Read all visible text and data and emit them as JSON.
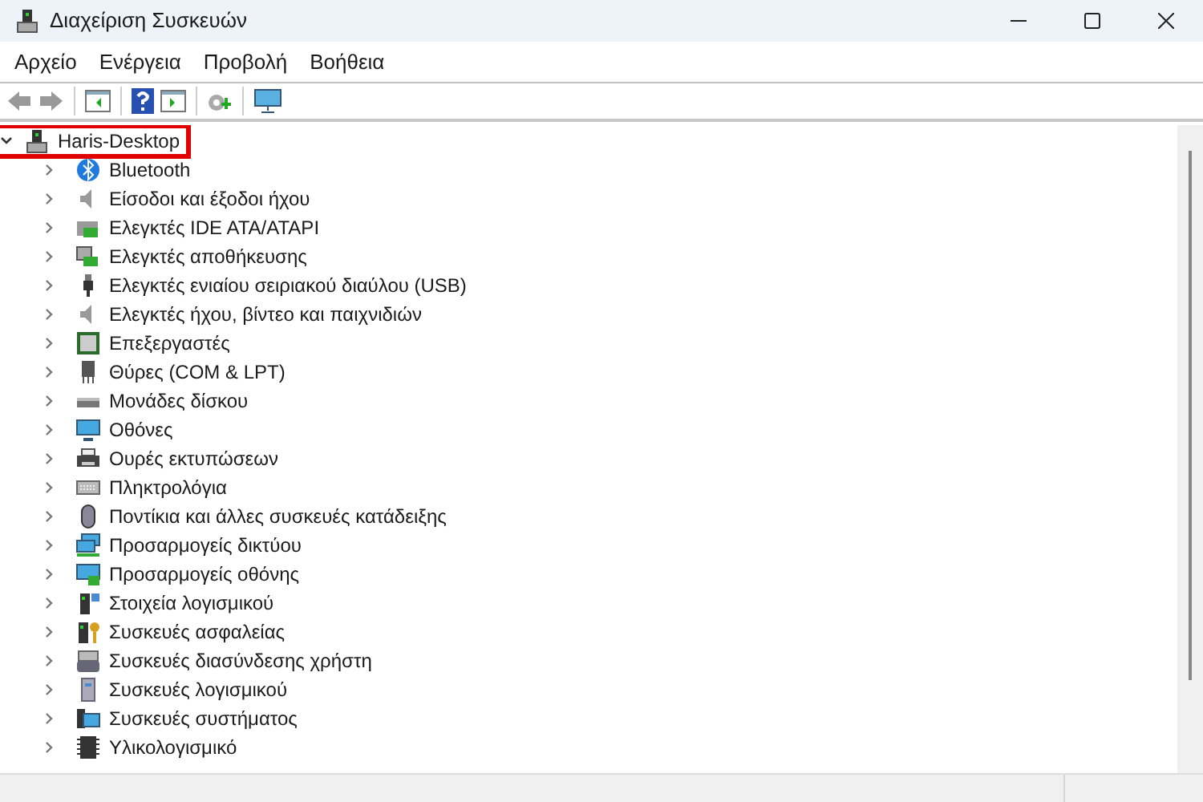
{
  "window": {
    "title": "Διαχείριση Συσκευών"
  },
  "menu": [
    "Αρχείο",
    "Ενέργεια",
    "Προβολή",
    "Βοήθεια"
  ],
  "tree": {
    "label": "Haris-Desktop",
    "expanded": true,
    "highlighted": true,
    "children": [
      {
        "label": "Bluetooth",
        "expanded": false
      },
      {
        "label": "Είσοδοι και έξοδοι ήχου",
        "expanded": false
      },
      {
        "label": "Ελεγκτές IDE ATA/ATAPI",
        "expanded": false
      },
      {
        "label": "Ελεγκτές αποθήκευσης",
        "expanded": false
      },
      {
        "label": "Ελεγκτές ενιαίου σειριακού διαύλου (USB)",
        "expanded": false
      },
      {
        "label": "Ελεγκτές ήχου, βίντεο και παιχνιδιών",
        "expanded": false
      },
      {
        "label": "Επεξεργαστές",
        "expanded": false
      },
      {
        "label": "Θύρες (COM & LPT)",
        "expanded": false
      },
      {
        "label": "Μονάδες δίσκου",
        "expanded": false
      },
      {
        "label": "Οθόνες",
        "expanded": false
      },
      {
        "label": "Ουρές εκτυπώσεων",
        "expanded": false
      },
      {
        "label": "Πληκτρολόγια",
        "expanded": false
      },
      {
        "label": "Ποντίκια και άλλες συσκευές κατάδειξης",
        "expanded": false
      },
      {
        "label": "Προσαρμογείς δικτύου",
        "expanded": false
      },
      {
        "label": "Προσαρμογείς οθόνης",
        "expanded": false
      },
      {
        "label": "Στοιχεία λογισμικού",
        "expanded": false
      },
      {
        "label": "Συσκευές ασφαλείας",
        "expanded": false
      },
      {
        "label": "Συσκευές διασύνδεσης χρήστη",
        "expanded": false
      },
      {
        "label": "Συσκευές λογισμικού",
        "expanded": false
      },
      {
        "label": "Συσκευές συστήματος",
        "expanded": false
      },
      {
        "label": "Υλικολογισμικό",
        "expanded": false
      }
    ]
  }
}
